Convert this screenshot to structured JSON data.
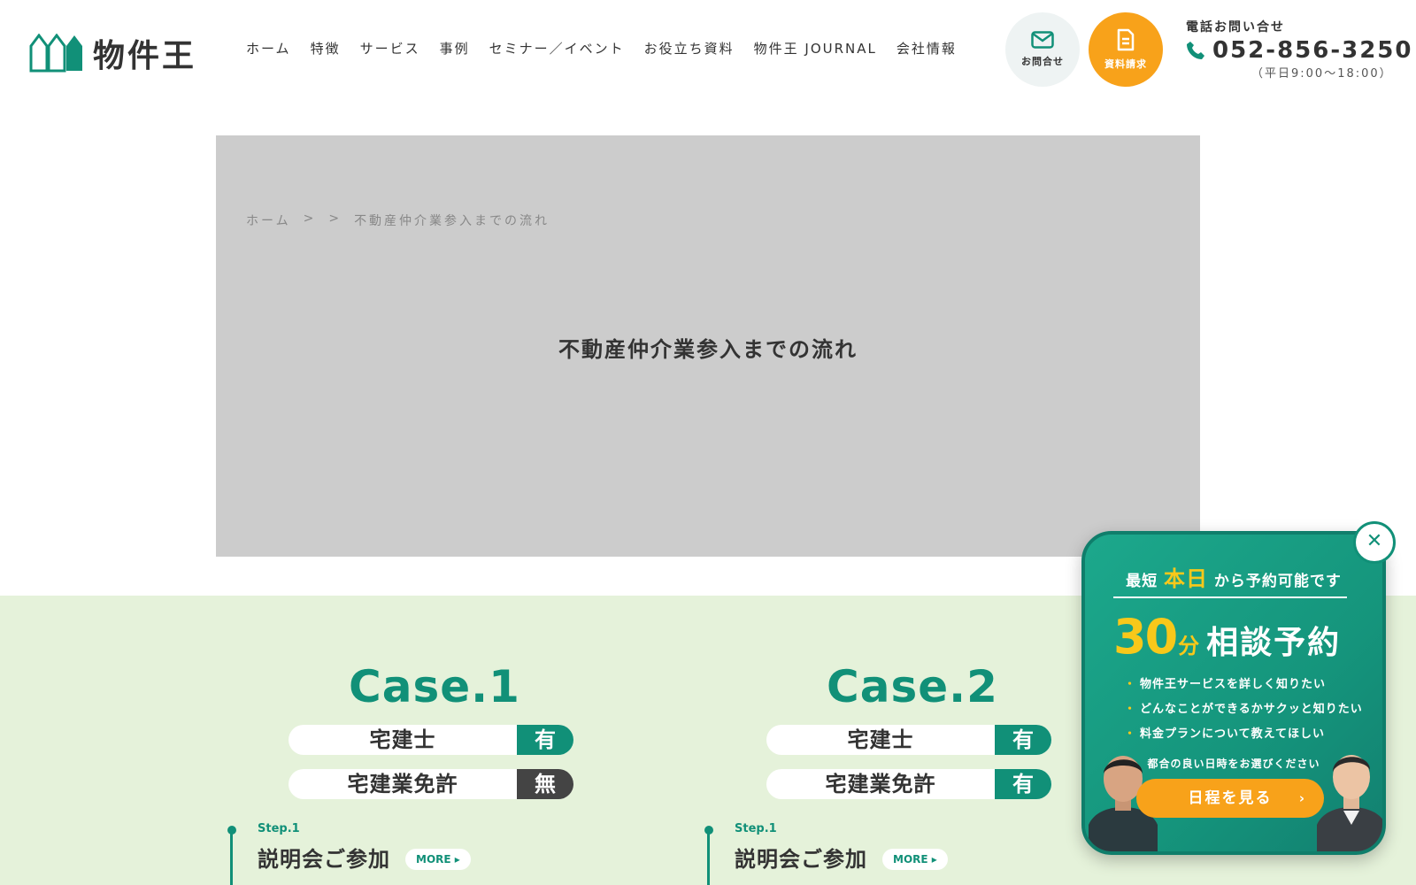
{
  "header": {
    "logo_text": "物件王",
    "nav": [
      {
        "label": "ホーム"
      },
      {
        "label": "特徴"
      },
      {
        "label": "サービス"
      },
      {
        "label": "事例"
      },
      {
        "label": "セミナー／イベント"
      },
      {
        "label": "お役立ち資料"
      },
      {
        "label": "物件王 JOURNAL"
      },
      {
        "label": "会社情報"
      }
    ],
    "contact_label": "お問合せ",
    "docs_label": "資料請求",
    "phone_label": "電話お問い合せ",
    "phone_number": "052-856-3250",
    "phone_hours": "（平日9:00〜18:00）"
  },
  "hero": {
    "breadcrumb_home": "ホーム",
    "breadcrumb_sep1": ">",
    "breadcrumb_sep2": ">",
    "breadcrumb_current": "不動産仲介業参入までの流れ",
    "title": "不動産仲介業参入までの流れ"
  },
  "cases": [
    {
      "title": "Case.1",
      "rows": [
        {
          "label": "宅建士",
          "value": "有"
        },
        {
          "label": "宅建業免許",
          "value": "無"
        }
      ],
      "step_label": "Step.1",
      "step_title": "説明会ご参加",
      "more": "MORE ▸"
    },
    {
      "title": "Case.2",
      "rows": [
        {
          "label": "宅建士",
          "value": "有"
        },
        {
          "label": "宅建業免許",
          "value": "有"
        }
      ],
      "step_label": "Step.1",
      "step_title": "説明会ご参加",
      "more": "MORE ▸"
    }
  ],
  "popup": {
    "top_pre": "最短",
    "top_highlight": "本日",
    "top_post": "から予約可能です",
    "num": "30",
    "unit": "分",
    "head": "相談予約",
    "list": [
      "物件王サービスを詳しく知りたい",
      "どんなことができるかサクッと知りたい",
      "料金プランについて教えてほしい"
    ],
    "sub": "都合の良い日時をお選びください",
    "cta": "日程を見る",
    "cta_arrow": "›",
    "close": "✕"
  },
  "colors": {
    "brand_green": "#119078",
    "accent_orange": "#f8a21a",
    "section_bg": "#e5f2da",
    "hero_bg": "#cccccc"
  }
}
